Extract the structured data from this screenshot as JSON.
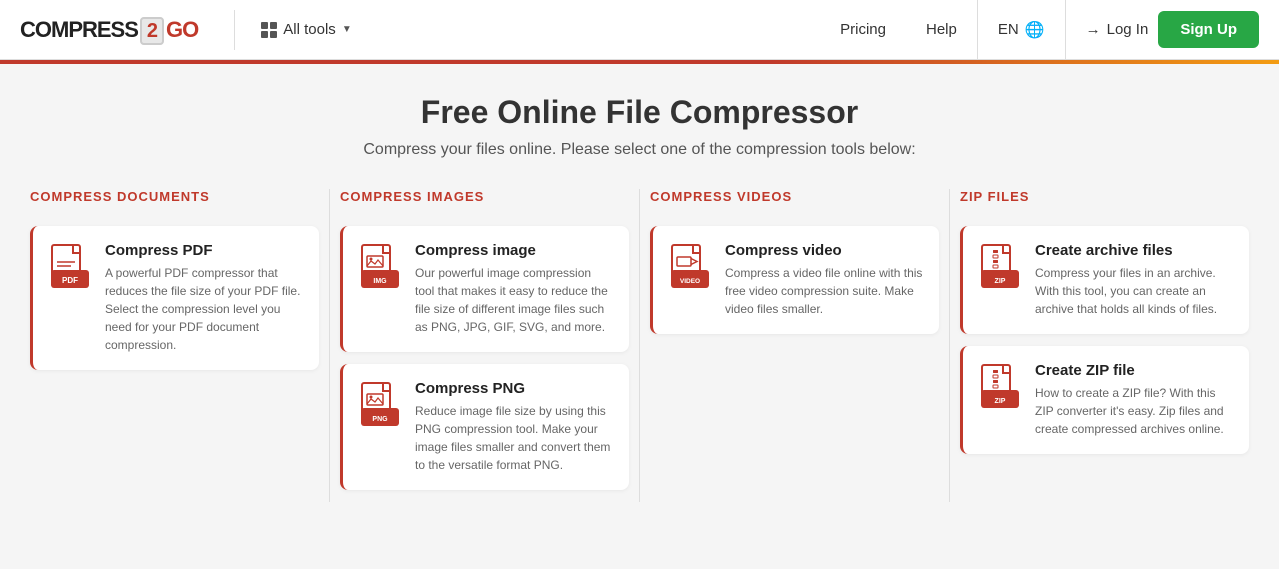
{
  "header": {
    "logo_text_compress": "COMPRESS",
    "logo_2": "2",
    "logo_go": "GO",
    "all_tools_label": "All tools",
    "nav_pricing": "Pricing",
    "nav_help": "Help",
    "lang_code": "EN",
    "login_label": "Log In",
    "signup_label": "Sign Up"
  },
  "page": {
    "title": "Free Online File Compressor",
    "subtitle": "Compress your files online. Please select one of the compression tools below:"
  },
  "columns": [
    {
      "header": "COMPRESS DOCUMENTS",
      "tools": [
        {
          "title": "Compress PDF",
          "desc": "A powerful PDF compressor that reduces the file size of your PDF file. Select the compression level you need for your PDF document compression.",
          "icon_type": "pdf"
        }
      ]
    },
    {
      "header": "COMPRESS IMAGES",
      "tools": [
        {
          "title": "Compress image",
          "desc": "Our powerful image compression tool that makes it easy to reduce the file size of different image files such as PNG, JPG, GIF, SVG, and more.",
          "icon_type": "image"
        },
        {
          "title": "Compress PNG",
          "desc": "Reduce image file size by using this PNG compression tool. Make your image files smaller and convert them to the versatile format PNG.",
          "icon_type": "image"
        }
      ]
    },
    {
      "header": "COMPRESS VIDEOS",
      "tools": [
        {
          "title": "Compress video",
          "desc": "Compress a video file online with this free video compression suite. Make video files smaller.",
          "icon_type": "video"
        }
      ]
    },
    {
      "header": "ZIP FILES",
      "tools": [
        {
          "title": "Create archive files",
          "desc": "Compress your files in an archive. With this tool, you can create an archive that holds all kinds of files.",
          "icon_type": "zip"
        },
        {
          "title": "Create ZIP file",
          "desc": "How to create a ZIP file? With this ZIP converter it's easy. Zip files and create compressed archives online.",
          "icon_type": "zip"
        }
      ]
    }
  ]
}
